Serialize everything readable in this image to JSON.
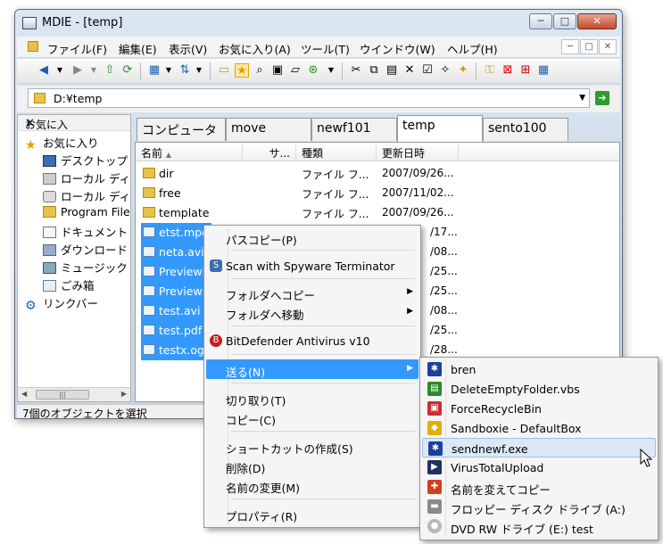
{
  "window": {
    "title": "MDIE - [temp]"
  },
  "menu": [
    "ファイル(F)",
    "編集(E)",
    "表示(V)",
    "お気に入り(A)",
    "ツール(T)",
    "ウインドウ(W)",
    "ヘルプ(H)"
  ],
  "address": {
    "value": "D:¥temp"
  },
  "left_pane": {
    "title": "お気に入",
    "items": [
      "お気に入り",
      "デスクトップ",
      "ローカル ディ",
      "ローカル ディ",
      "Program Files",
      "ドキュメント",
      "ダウンロード",
      "ミュージック",
      "ごみ箱",
      "リンクバー"
    ]
  },
  "tabs": [
    "コンピュータ",
    "move",
    "newf101",
    "temp",
    "sento100"
  ],
  "columns": [
    "名前",
    "サ...",
    "種類",
    "更新日時"
  ],
  "files": [
    {
      "name": "dir",
      "type": "ファイル フ...",
      "date": "2007/09/26..."
    },
    {
      "name": "free",
      "type": "ファイル フ...",
      "date": "2007/11/02..."
    },
    {
      "name": "template",
      "type": "ファイル フ...",
      "date": "2007/09/26..."
    },
    {
      "name": "etst.mpg",
      "type": "",
      "date": "/17..."
    },
    {
      "name": "neta.avi",
      "type": "",
      "date": "/08..."
    },
    {
      "name": "PreviewF",
      "type": "",
      "date": "/25..."
    },
    {
      "name": "PreviewF",
      "type": "",
      "date": "/25..."
    },
    {
      "name": "test.avi",
      "type": "",
      "date": "/08..."
    },
    {
      "name": "test.pdf",
      "type": "",
      "date": "/25..."
    },
    {
      "name": "testx.ogn",
      "type": "",
      "date": "/28..."
    }
  ],
  "status": "7個のオブジェクトを選択",
  "context_menu": {
    "copy_path": "パスコピー(P)",
    "scan": "Scan with Spyware Terminator",
    "copy_to_folder": "フォルダへコピー",
    "move_to_folder": "フォルダへ移動",
    "bitdefender": "BitDefender Antivirus v10",
    "send_to": "送る(N)",
    "cut": "切り取り(T)",
    "copy": "コピー(C)",
    "create_shortcut": "ショートカットの作成(S)",
    "delete": "削除(D)",
    "rename": "名前の変更(M)",
    "properties": "プロパティ(R)"
  },
  "send_to_menu": [
    "bren",
    "DeleteEmptyFolder.vbs",
    "ForceRecycleBin",
    "Sandboxie - DefaultBox",
    "sendnewf.exe",
    "VirusTotalUpload",
    "名前を変えてコピー",
    "フロッピー ディスク ドライブ (A:)",
    "DVD RW ドライブ (E:) test"
  ],
  "window_buttons": {
    "minimize": "─",
    "maximize": "□",
    "close": "✕"
  },
  "colors": {
    "selection": "#3399ff",
    "menu_hover": "#dde8f5"
  }
}
